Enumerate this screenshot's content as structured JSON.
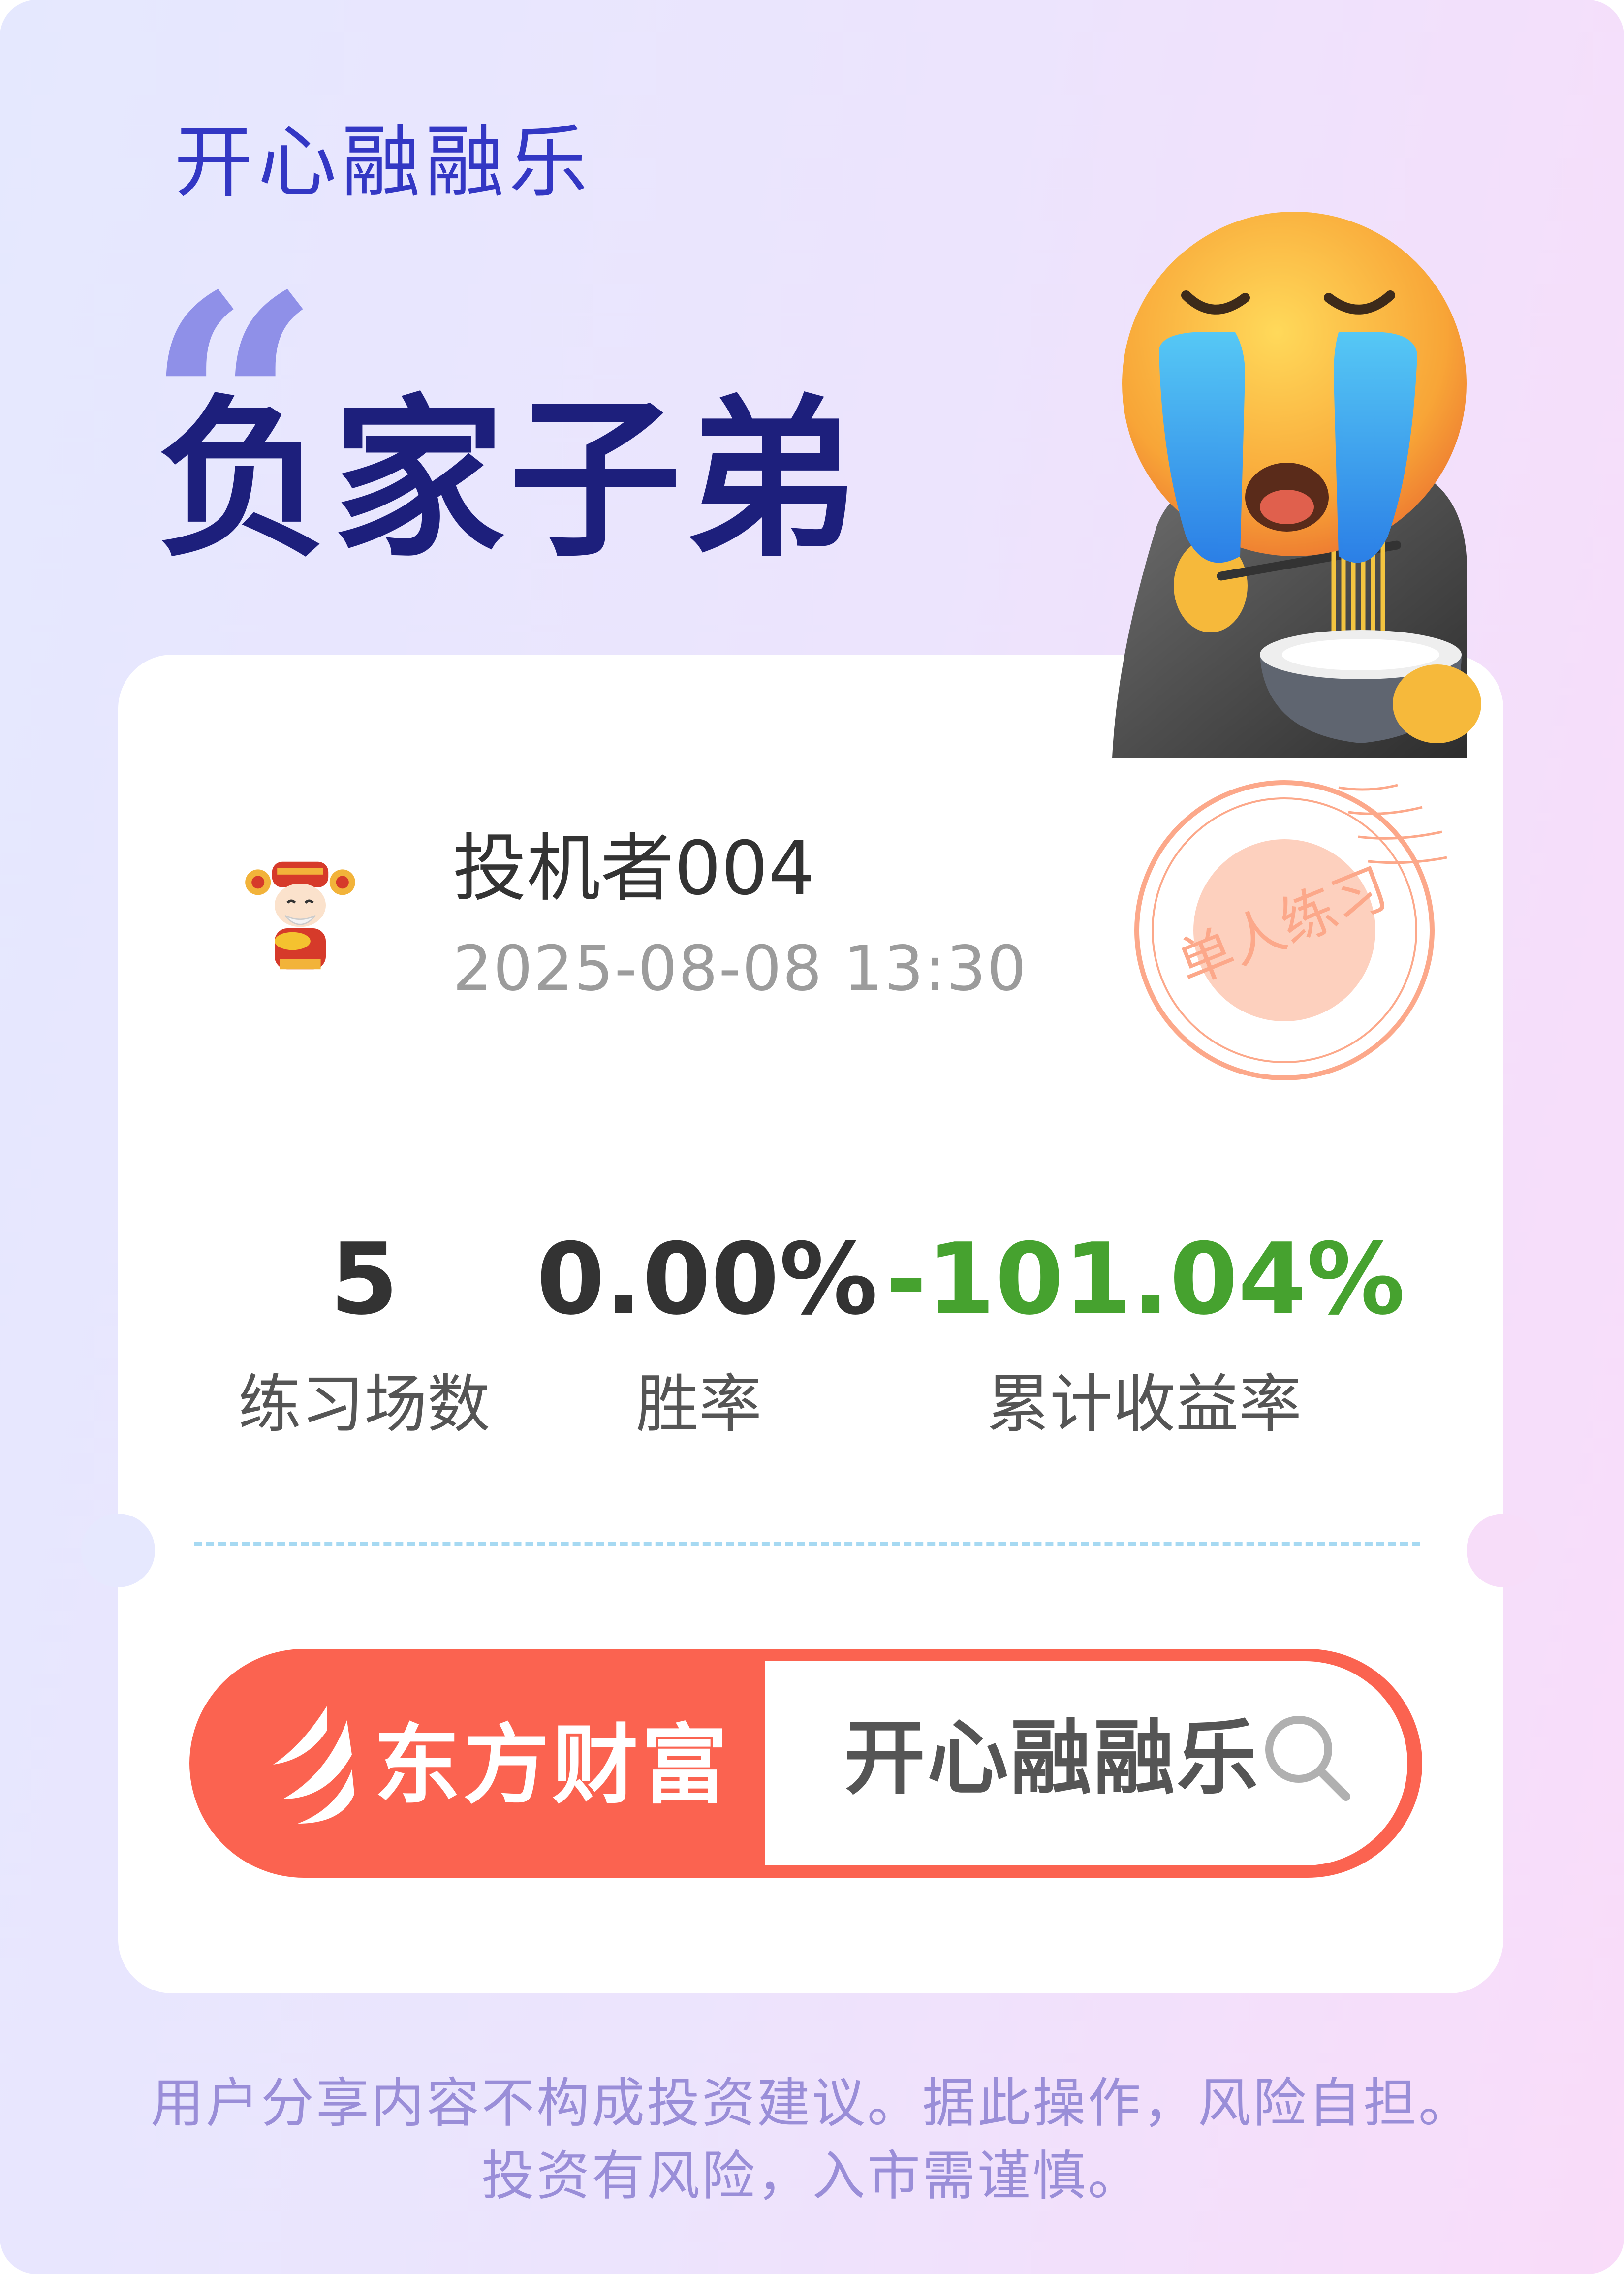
{
  "header": {
    "app_title": "开心融融乐",
    "quote_mark": "“",
    "headline": "负家子弟"
  },
  "user": {
    "name": "投机者004",
    "timestamp": "2025-08-08 13:30",
    "avatar_icon": "god-of-wealth-avatar-icon"
  },
  "stamp": {
    "text": "单人练习",
    "color": "#fb8c63"
  },
  "sticker_icon": "crying-face-eating-noodles-icon",
  "stats": [
    {
      "value": "5",
      "label": "练习场数"
    },
    {
      "value": "0.00%",
      "label": "胜率"
    },
    {
      "value": "-101.04%",
      "label": "累计收益率",
      "color": "#46a22f"
    }
  ],
  "brand": {
    "name": "东方财富",
    "search_text": "开心融融乐",
    "accent": "#fb6350"
  },
  "disclaimer": {
    "line1": "用户分享内容不构成投资建议。据此操作，风险自担。",
    "line2": "投资有风险，入市需谨慎。"
  }
}
